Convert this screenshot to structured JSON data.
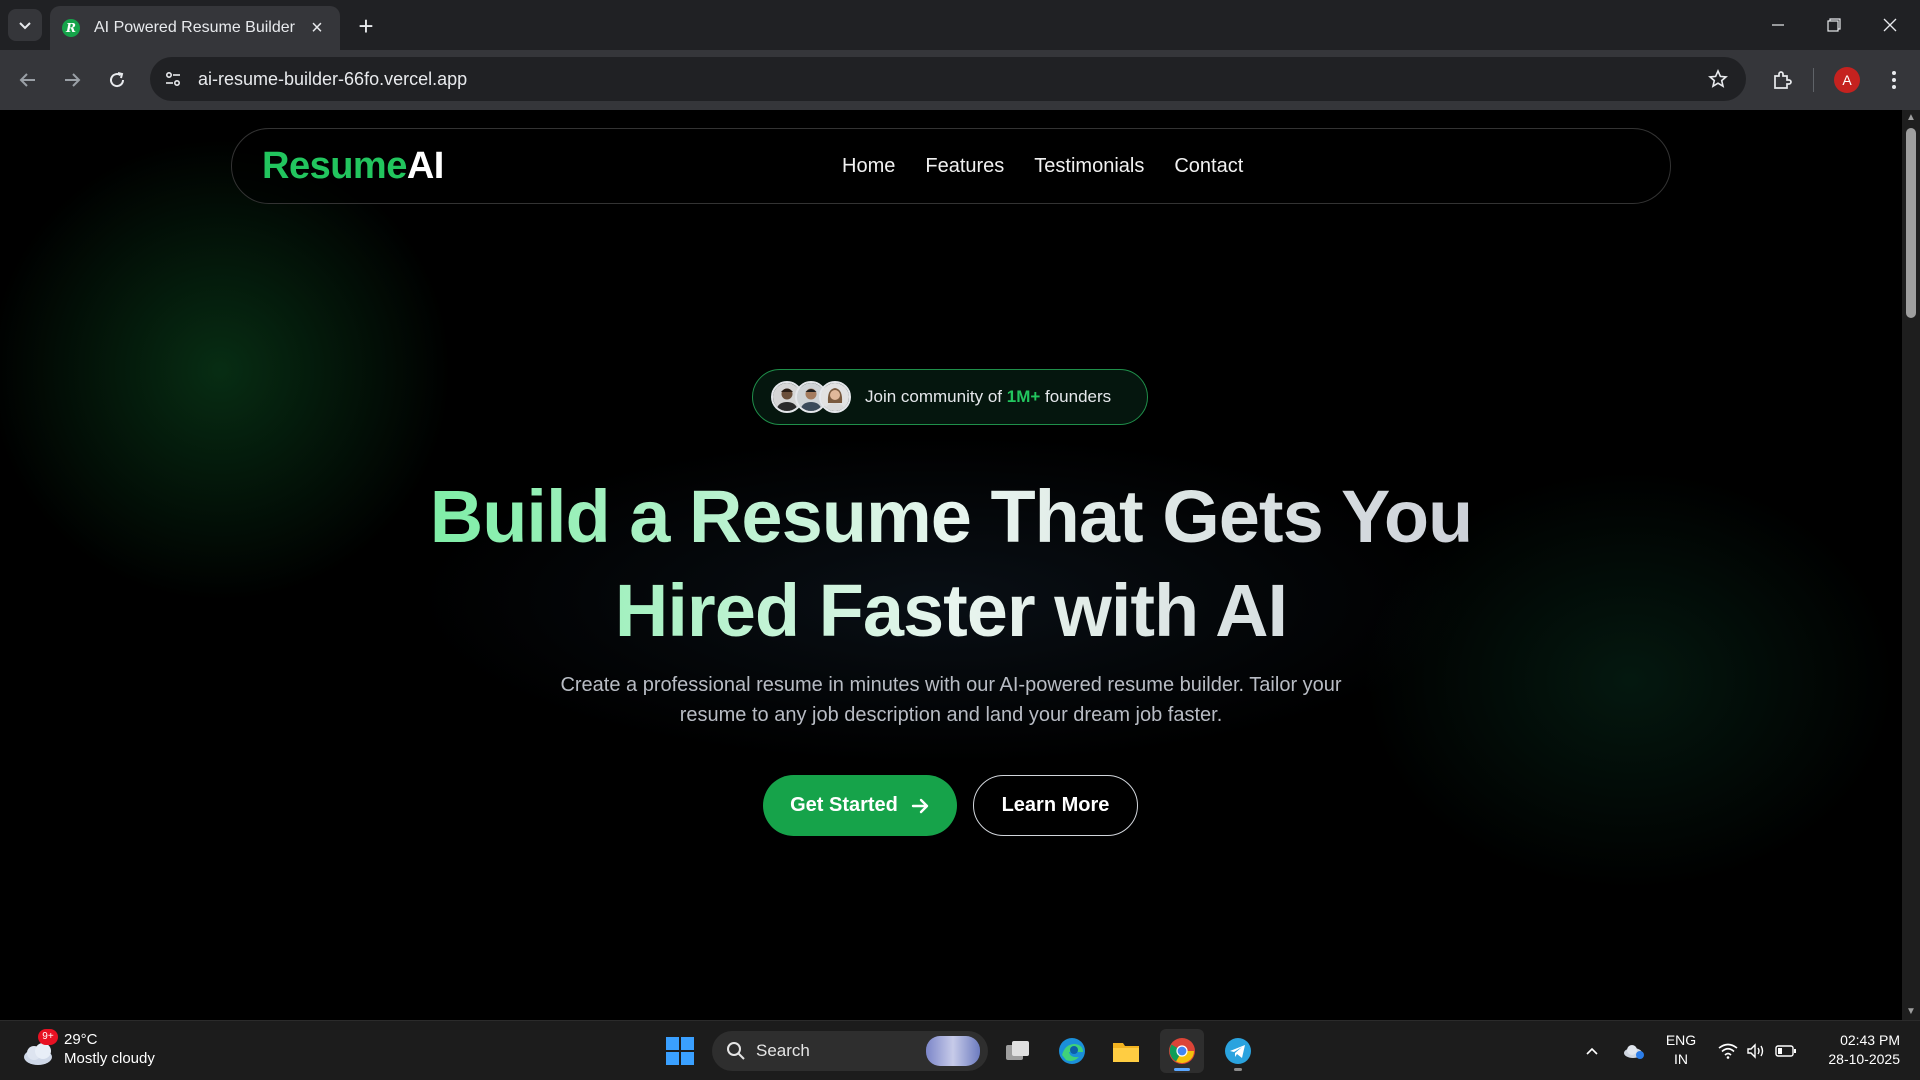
{
  "browser": {
    "tab_title": "AI Powered Resume Builder",
    "favicon_letter": "R",
    "url": "ai-resume-builder-66fo.vercel.app",
    "profile_initial": "A"
  },
  "site": {
    "logo_green": "Resume",
    "logo_white": "AI",
    "nav": [
      "Home",
      "Features",
      "Testimonials",
      "Contact"
    ],
    "badge": {
      "prefix": "Join community of ",
      "highlight": "1M+",
      "suffix": " founders"
    },
    "headline_line1": "Build a Resume That Gets You",
    "headline_line2": "Hired Faster with AI",
    "subtext": "Create a professional resume in minutes with our AI-powered resume builder. Tailor your resume to any job description and land your dream job faster.",
    "cta_primary": "Get Started",
    "cta_secondary": "Learn More",
    "colors": {
      "accent": "#22c55e",
      "button": "#16a34a"
    }
  },
  "taskbar": {
    "weather_badge": "9+",
    "temperature": "29°C",
    "condition": "Mostly cloudy",
    "search_label": "Search",
    "lang_line1": "ENG",
    "lang_line2": "IN",
    "time": "02:43 PM",
    "date": "28-10-2025"
  }
}
